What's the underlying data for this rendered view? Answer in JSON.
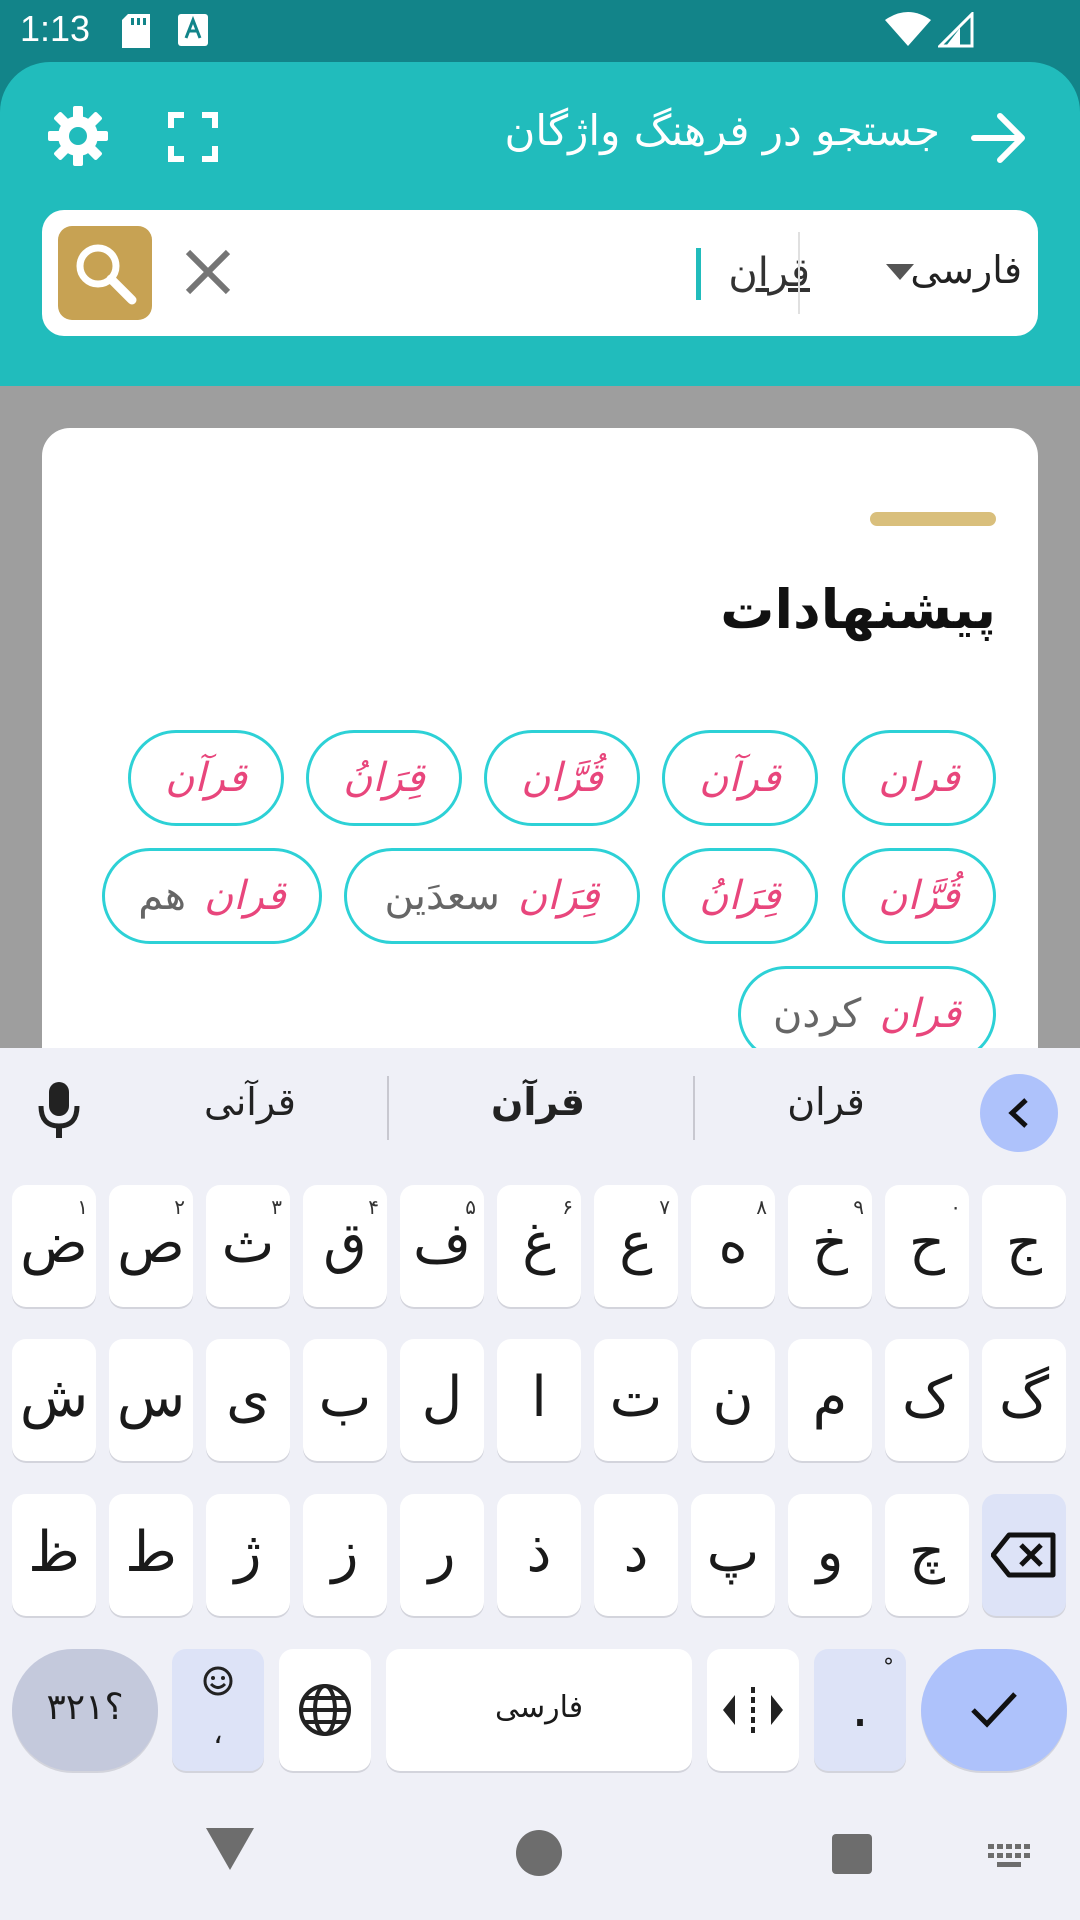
{
  "status_bar": {
    "time": "1:13"
  },
  "header": {
    "title": "جستجو در فرهنگ واژگان"
  },
  "search": {
    "value": "قران",
    "language": "فارسی"
  },
  "suggestions": {
    "title": "پیشنهادات",
    "chips": [
      {
        "main": "قران",
        "extra": ""
      },
      {
        "main": "قرآن",
        "extra": ""
      },
      {
        "main": "قُرَّان",
        "extra": ""
      },
      {
        "main": "قِرَانُ",
        "extra": ""
      },
      {
        "main": "قرآن",
        "extra": ""
      },
      {
        "main": "قُرَّان",
        "extra": ""
      },
      {
        "main": "قِرَانُ",
        "extra": ""
      },
      {
        "main": "قِرَان",
        "extra": "سعدَین"
      },
      {
        "main": "قران",
        "extra": "هم"
      },
      {
        "main": "قران",
        "extra": "کردن"
      }
    ]
  },
  "keyboard": {
    "strip": [
      "قران",
      "قرآن",
      "قرآنی"
    ],
    "row1": [
      {
        "k": "ج",
        "h": ""
      },
      {
        "k": "ح",
        "h": "۰"
      },
      {
        "k": "خ",
        "h": "۹"
      },
      {
        "k": "ه",
        "h": "۸"
      },
      {
        "k": "ع",
        "h": "۷"
      },
      {
        "k": "غ",
        "h": "۶"
      },
      {
        "k": "ف",
        "h": "۵"
      },
      {
        "k": "ق",
        "h": "۴"
      },
      {
        "k": "ث",
        "h": "۳"
      },
      {
        "k": "ص",
        "h": "۲"
      },
      {
        "k": "ض",
        "h": "۱"
      }
    ],
    "row2": [
      "گ",
      "ک",
      "م",
      "ن",
      "ت",
      "ا",
      "ل",
      "ب",
      "ی",
      "س",
      "ش"
    ],
    "row3": [
      "چ",
      "و",
      "پ",
      "د",
      "ذ",
      "ر",
      "ز",
      "ژ",
      "ط",
      "ظ"
    ],
    "symbols_label": "؟۳۲۱",
    "emoji_sub": "،",
    "space_label": "فارسی",
    "period_label": "."
  }
}
